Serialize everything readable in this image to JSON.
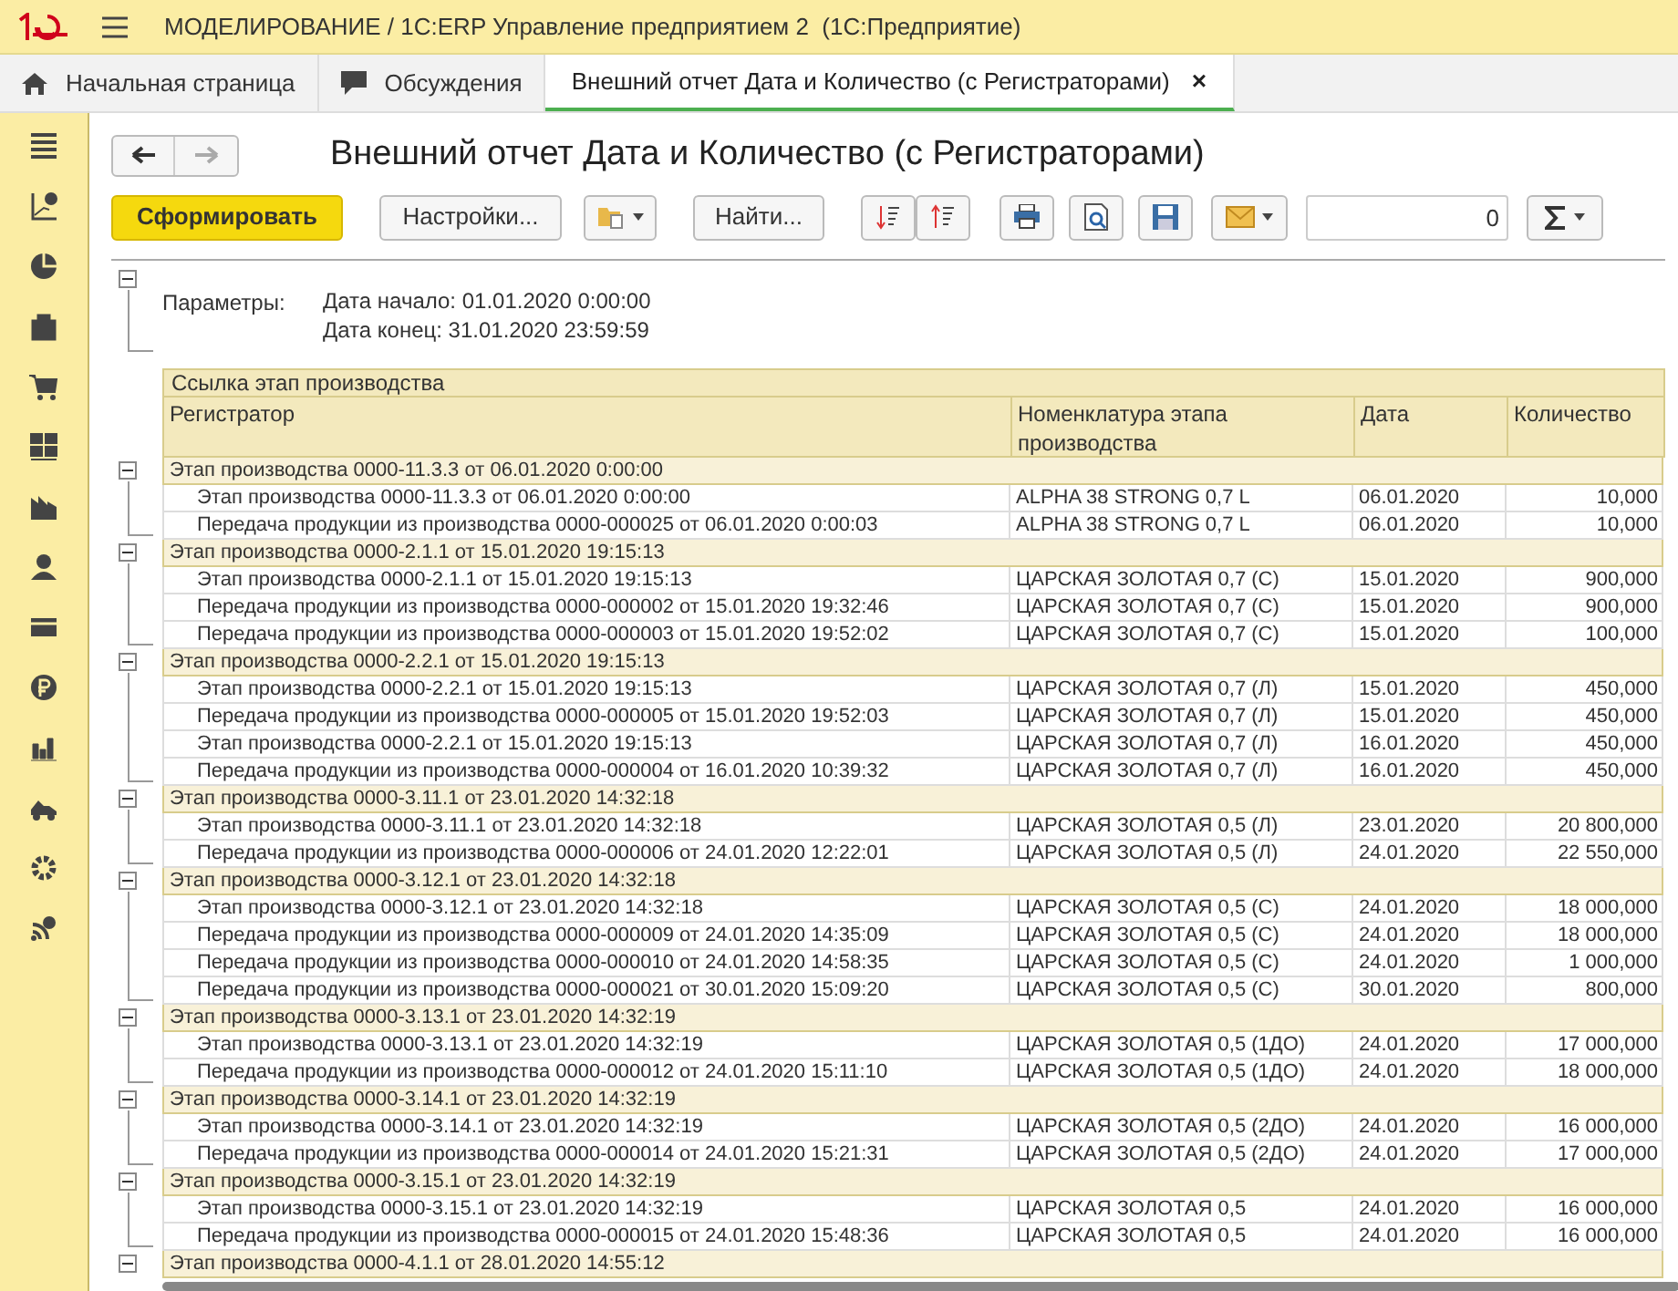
{
  "app_title": "МОДЕЛИРОВАНИЕ / 1С:ERP Управление предприятием 2  (1С:Предприятие)",
  "tabs": [
    {
      "label": "Начальная страница",
      "kind": "home",
      "selected": false
    },
    {
      "label": "Обсуждения",
      "kind": "chat",
      "selected": false
    },
    {
      "label": "Внешний отчет Дата и Количество (с Регистраторами)",
      "kind": "document",
      "selected": true,
      "close": "×"
    }
  ],
  "report_title": "Внешний отчет Дата и Количество (с Регистраторами)",
  "toolbar": {
    "generate": "Сформировать",
    "settings": "Настройки...",
    "find": "Найти...",
    "number_value": "0"
  },
  "parameters": {
    "label": "Параметры:",
    "lines": [
      "Дата начало: 01.01.2020 0:00:00",
      "Дата конец: 31.01.2020 23:59:59"
    ]
  },
  "table": {
    "group_heading": "Ссылка этап производства",
    "columns": [
      "Регистратор",
      "Номенклатура этапа производства",
      "Дата",
      "Количество"
    ],
    "groups": [
      {
        "header": "Этап производства 0000-11.3.3 от 06.01.2020 0:00:00",
        "expanded": true,
        "rows": [
          [
            "Этап производства 0000-11.3.3 от 06.01.2020 0:00:00",
            "ALPHA 38 STRONG 0,7 L",
            "06.01.2020",
            "10,000"
          ],
          [
            "Передача продукции из производства 0000-000025 от 06.01.2020 0:00:03",
            "ALPHA 38 STRONG 0,7 L",
            "06.01.2020",
            "10,000"
          ]
        ]
      },
      {
        "header": "Этап производства 0000-2.1.1 от 15.01.2020 19:15:13",
        "expanded": true,
        "rows": [
          [
            "Этап производства 0000-2.1.1 от 15.01.2020 19:15:13",
            "ЦАРСКАЯ ЗОЛОТАЯ 0,7 (С)",
            "15.01.2020",
            "900,000"
          ],
          [
            "Передача продукции из производства 0000-000002 от 15.01.2020 19:32:46",
            "ЦАРСКАЯ ЗОЛОТАЯ 0,7 (С)",
            "15.01.2020",
            "900,000"
          ],
          [
            "Передача продукции из производства 0000-000003 от 15.01.2020 19:52:02",
            "ЦАРСКАЯ ЗОЛОТАЯ 0,7 (С)",
            "15.01.2020",
            "100,000"
          ]
        ]
      },
      {
        "header": "Этап производства 0000-2.2.1 от 15.01.2020 19:15:13",
        "expanded": true,
        "rows": [
          [
            "Этап производства 0000-2.2.1 от 15.01.2020 19:15:13",
            "ЦАРСКАЯ ЗОЛОТАЯ 0,7 (Л)",
            "15.01.2020",
            "450,000"
          ],
          [
            "Передача продукции из производства 0000-000005 от 15.01.2020 19:52:03",
            "ЦАРСКАЯ ЗОЛОТАЯ 0,7 (Л)",
            "15.01.2020",
            "450,000"
          ],
          [
            "Этап производства 0000-2.2.1 от 15.01.2020 19:15:13",
            "ЦАРСКАЯ ЗОЛОТАЯ 0,7 (Л)",
            "16.01.2020",
            "450,000"
          ],
          [
            "Передача продукции из производства 0000-000004 от 16.01.2020 10:39:32",
            "ЦАРСКАЯ ЗОЛОТАЯ 0,7 (Л)",
            "16.01.2020",
            "450,000"
          ]
        ]
      },
      {
        "header": "Этап производства 0000-3.11.1 от 23.01.2020 14:32:18",
        "expanded": true,
        "rows": [
          [
            "Этап производства 0000-3.11.1 от 23.01.2020 14:32:18",
            "ЦАРСКАЯ ЗОЛОТАЯ 0,5 (Л)",
            "23.01.2020",
            "20 800,000"
          ],
          [
            "Передача продукции из производства 0000-000006 от 24.01.2020 12:22:01",
            "ЦАРСКАЯ ЗОЛОТАЯ 0,5 (Л)",
            "24.01.2020",
            "22 550,000"
          ]
        ]
      },
      {
        "header": "Этап производства 0000-3.12.1 от 23.01.2020 14:32:18",
        "expanded": true,
        "rows": [
          [
            "Этап производства 0000-3.12.1 от 23.01.2020 14:32:18",
            "ЦАРСКАЯ ЗОЛОТАЯ 0,5 (С)",
            "24.01.2020",
            "18 000,000"
          ],
          [
            "Передача продукции из производства 0000-000009 от 24.01.2020 14:35:09",
            "ЦАРСКАЯ ЗОЛОТАЯ 0,5 (С)",
            "24.01.2020",
            "18 000,000"
          ],
          [
            "Передача продукции из производства 0000-000010 от 24.01.2020 14:58:35",
            "ЦАРСКАЯ ЗОЛОТАЯ 0,5 (С)",
            "24.01.2020",
            "1 000,000"
          ],
          [
            "Передача продукции из производства 0000-000021 от 30.01.2020 15:09:20",
            "ЦАРСКАЯ ЗОЛОТАЯ 0,5 (С)",
            "30.01.2020",
            "800,000"
          ]
        ]
      },
      {
        "header": "Этап производства 0000-3.13.1 от 23.01.2020 14:32:19",
        "expanded": true,
        "rows": [
          [
            "Этап производства 0000-3.13.1 от 23.01.2020 14:32:19",
            "ЦАРСКАЯ ЗОЛОТАЯ 0,5 (1ДО)",
            "24.01.2020",
            "17 000,000"
          ],
          [
            "Передача продукции из производства 0000-000012 от 24.01.2020 15:11:10",
            "ЦАРСКАЯ ЗОЛОТАЯ 0,5 (1ДО)",
            "24.01.2020",
            "18 000,000"
          ]
        ]
      },
      {
        "header": "Этап производства 0000-3.14.1 от 23.01.2020 14:32:19",
        "expanded": true,
        "rows": [
          [
            "Этап производства 0000-3.14.1 от 23.01.2020 14:32:19",
            "ЦАРСКАЯ ЗОЛОТАЯ 0,5 (2ДО)",
            "24.01.2020",
            "16 000,000"
          ],
          [
            "Передача продукции из производства 0000-000014 от 24.01.2020 15:21:31",
            "ЦАРСКАЯ ЗОЛОТАЯ 0,5 (2ДО)",
            "24.01.2020",
            "17 000,000"
          ]
        ]
      },
      {
        "header": "Этап производства 0000-3.15.1 от 23.01.2020 14:32:19",
        "expanded": true,
        "rows": [
          [
            "Этап производства 0000-3.15.1 от 23.01.2020 14:32:19",
            "ЦАРСКАЯ ЗОЛОТАЯ 0,5",
            "24.01.2020",
            "16 000,000"
          ],
          [
            "Передача продукции из производства 0000-000015 от 24.01.2020 15:48:36",
            "ЦАРСКАЯ ЗОЛОТАЯ 0,5",
            "24.01.2020",
            "16 000,000"
          ]
        ]
      },
      {
        "header": "Этап производства 0000-4.1.1 от 28.01.2020 14:55:12",
        "expanded": true
      }
    ]
  }
}
